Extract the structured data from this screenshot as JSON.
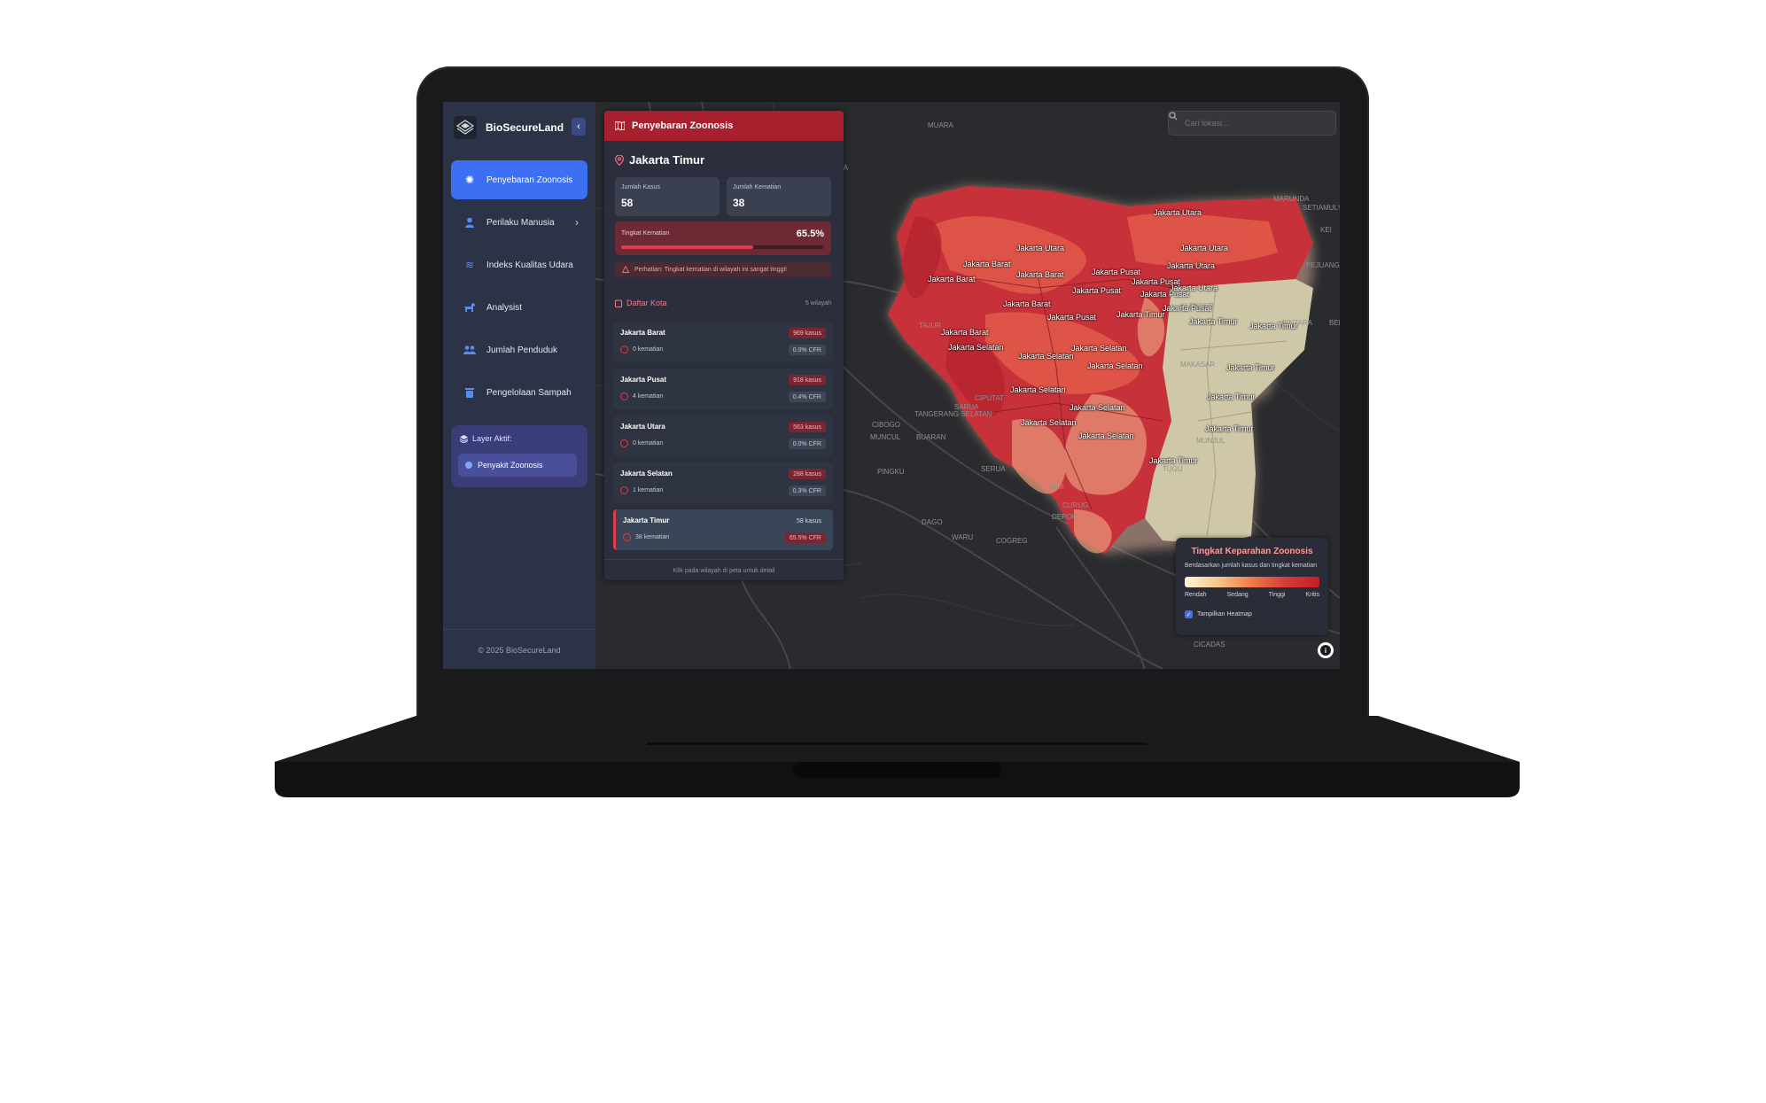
{
  "sidebar": {
    "brand": "BioSecureLand",
    "items": [
      {
        "label": "Penyebaran Zoonosis",
        "icon": "virus-icon"
      },
      {
        "label": "Perilaku Manusia",
        "icon": "user-icon"
      },
      {
        "label": "Indeks Kualitas Udara",
        "icon": "wind-icon"
      },
      {
        "label": "Analysist",
        "icon": "dog-icon"
      },
      {
        "label": "Jumlah Penduduk",
        "icon": "users-icon"
      },
      {
        "label": "Pengelolaan Sampah",
        "icon": "trash-icon"
      }
    ],
    "layer_title": "Layer Aktif:",
    "layer_item": "Penyakit Zoonosis",
    "footer": "© 2025 BioSecureLand"
  },
  "panel": {
    "title": "Penyebaran Zoonosis",
    "region": "Jakarta Timur",
    "cases_label": "Jumlah Kasus",
    "cases_value": "58",
    "deaths_label": "Jumlah Kematian",
    "deaths_value": "38",
    "mortality_label": "Tingkat Kematian",
    "mortality_value": "65.5%",
    "mortality_fraction": 0.655,
    "warning": "Perhatian: Tingkat kematian di wilayah ini sangat tinggi!",
    "list_title": "Daftar Kota",
    "list_count": "5 wilayah",
    "cities": [
      {
        "name": "Jakarta Barat",
        "cases": "969 kasus",
        "deaths": "0 kematian",
        "cfr": "0.0% CFR"
      },
      {
        "name": "Jakarta Pusat",
        "cases": "918 kasus",
        "deaths": "4 kematian",
        "cfr": "0.4% CFR"
      },
      {
        "name": "Jakarta Utara",
        "cases": "563 kasus",
        "deaths": "0 kematian",
        "cfr": "0.0% CFR"
      },
      {
        "name": "Jakarta Selatan",
        "cases": "288 kasus",
        "deaths": "1 kematian",
        "cfr": "0.3% CFR"
      },
      {
        "name": "Jakarta Timur",
        "cases": "58 kasus",
        "deaths": "38 kematian",
        "cfr": "65.5% CFR"
      }
    ],
    "footer": "Klik pada wilayah di peta untuk detail"
  },
  "map": {
    "search_placeholder": "Cari lokasi...",
    "places": [
      "MUARA",
      "HOD",
      "GAGA",
      "SETIAMULYA",
      "MARUNDA",
      "KEI",
      "PEJUANG",
      "BEKAS",
      "BINTARA",
      "GERANG",
      "TAJUR",
      "KLENDER",
      "MAKASAR",
      "CIPUTAT",
      "SARUA",
      "TANGERANG SELATAN",
      "CIBOGO",
      "MUNCUL",
      "BUARAN",
      "SERUA",
      "BEJI",
      "CURUG",
      "DEPOK",
      "COGREG",
      "WARU",
      "CICADAS",
      "PINGKU",
      "TAPOS",
      "DAGO",
      "TUGU",
      "MUNJUL",
      "DA",
      "SIB"
    ],
    "legend": {
      "title": "Tingkat Keparahan Zoonosis",
      "subtitle": "Berdasarkan jumlah kasus dan tingkat kematian",
      "labels": [
        "Rendah",
        "Sedang",
        "Tinggi",
        "Kritis"
      ],
      "toggle": "Tampilkan Heatmap"
    },
    "region_labels": [
      "Jakarta Utara",
      "Jakarta Utara",
      "Jakarta Utara",
      "Jakarta Utara",
      "Jakarta Utara",
      "Jakarta Barat",
      "Jakarta Barat",
      "Jakarta Barat",
      "Jakarta Barat",
      "Jakarta Barat",
      "Jakarta Pusat",
      "Jakarta Pusat",
      "Jakarta Pusat",
      "Jakarta Pusat",
      "Jakarta Pusat",
      "Jakarta Pusat",
      "Jakarta Selatan",
      "Jakarta Selatan",
      "Jakarta Selatan",
      "Jakarta Selatan",
      "Jakarta Selatan",
      "Jakarta Selatan",
      "Jakarta Selatan",
      "Jakarta Selatan",
      "Jakarta Timur",
      "Jakarta Timur",
      "Jakarta Timur",
      "Jakarta Timur",
      "Jakarta Timur",
      "Jakarta Timur",
      "Jakarta Timur"
    ]
  },
  "colors": {
    "accent": "#3d6ff2",
    "danger": "#e23a48",
    "panel_header": "#a8202e"
  }
}
